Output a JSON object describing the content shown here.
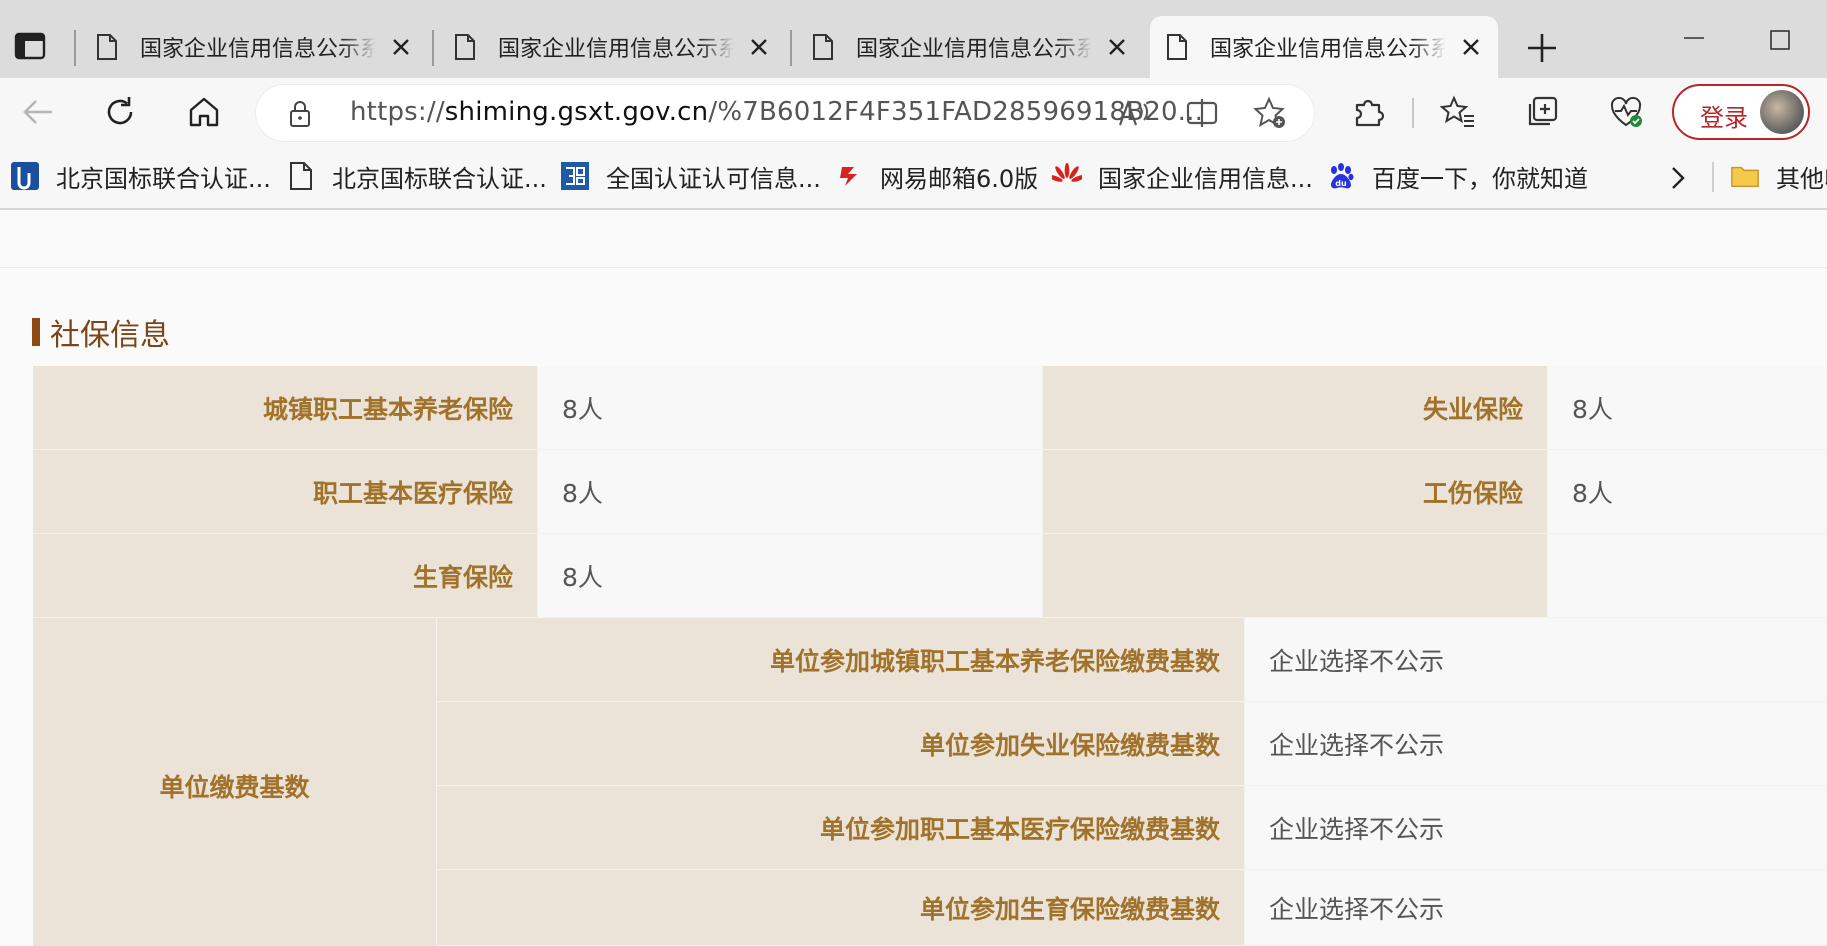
{
  "browser": {
    "tabs": [
      {
        "title": "国家企业信用信息公示系统",
        "active": false
      },
      {
        "title": "国家企业信用信息公示系统",
        "active": false
      },
      {
        "title": "国家企业信用信息公示系统",
        "active": false
      },
      {
        "title": "国家企业信用信息公示系统",
        "active": true
      }
    ],
    "url_scheme": "https://",
    "url_host": "shiming.gsxt.gov.cn",
    "url_path": "/%7B6012F4F351FAD28596918B20...",
    "login_label": "登录",
    "favorites": [
      {
        "label": "北京国标联合认证...",
        "icon": "bjgb-logo-icon"
      },
      {
        "label": "北京国标联合认证...",
        "icon": "page-icon"
      },
      {
        "label": "全国认证认可信息...",
        "icon": "cnca-logo-icon"
      },
      {
        "label": "网易邮箱6.0版",
        "icon": "netease-logo-icon"
      },
      {
        "label": "国家企业信用信息...",
        "icon": "huawei-logo-icon"
      },
      {
        "label": "百度一下，你就知道",
        "icon": "baidu-logo-icon"
      }
    ],
    "other_favorites_label": "其他收藏夹"
  },
  "page": {
    "section_title": "社保信息",
    "insurance_rows": [
      {
        "label1": "城镇职工基本养老保险",
        "value1": "8人",
        "label2": "失业保险",
        "value2": "8人"
      },
      {
        "label1": "职工基本医疗保险",
        "value1": "8人",
        "label2": "工伤保险",
        "value2": "8人"
      },
      {
        "label1": "生育保险",
        "value1": "8人",
        "label2": "",
        "value2": ""
      }
    ],
    "base_group_label": "单位缴费基数",
    "base_rows": [
      {
        "label": "单位参加城镇职工基本养老保险缴费基数",
        "value": "企业选择不公示"
      },
      {
        "label": "单位参加失业保险缴费基数",
        "value": "企业选择不公示"
      },
      {
        "label": "单位参加职工基本医疗保险缴费基数",
        "value": "企业选择不公示"
      },
      {
        "label": "单位参加生育保险缴费基数",
        "value": "企业选择不公示"
      }
    ]
  }
}
